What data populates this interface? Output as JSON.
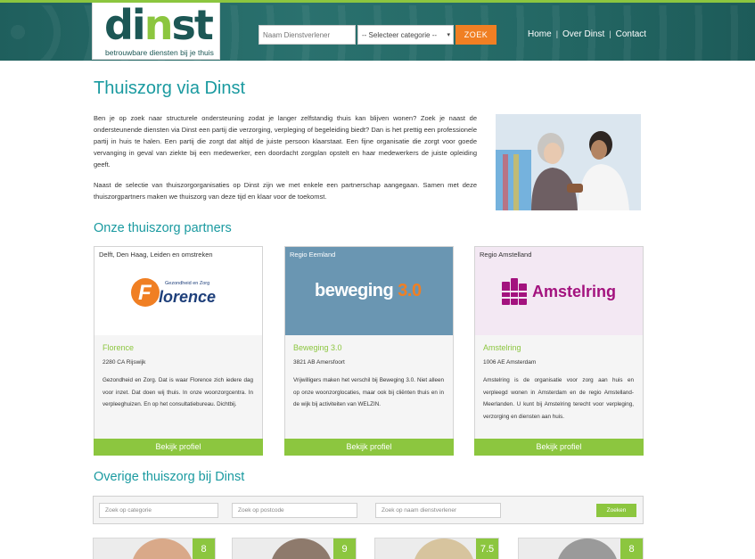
{
  "header": {
    "logo_text_dark": "di",
    "logo_text_dot": "n",
    "logo_text_rest": "st",
    "tagline": "betrouwbare diensten bij je thuis",
    "search_placeholder": "Naam Dienstverlener",
    "category_select": "-- Selecteer categorie --",
    "search_button": "ZOEK",
    "nav": [
      "Home",
      "Over Dinst",
      "Contact"
    ]
  },
  "intro": {
    "title": "Thuiszorg via Dinst",
    "paragraphs": [
      "Ben je op zoek naar structurele ondersteuning zodat je langer zelfstandig thuis kan blijven wonen? Zoek je naast de ondersteunende diensten via Dinst een partij die verzorging, verpleging of begeleiding biedt? Dan is het prettig een professionele partij in huis te halen. Een partij die zorgt dat altijd de juiste persoon klaarstaat. Een fijne organisatie die zorgt voor goede vervanging in geval van ziekte bij een medewerker, een doordacht zorgplan opstelt en haar medewerkers de juiste opleiding geeft.",
      "Naast de selectie van thuiszorgorganisaties op Dinst zijn we met enkele een partnerschap aangegaan. Samen met deze thuiszorgpartners maken we thuiszorg van deze tijd en klaar voor de toekomst."
    ]
  },
  "partners": {
    "title": "Onze thuiszorg partners",
    "cards": [
      {
        "region": "Delft, Den Haag, Leiden en omstreken",
        "logo_top": "Gezondheid en Zorg",
        "logo_main": "lorence",
        "name": "Florence",
        "address": "2280 CA Rijswijk",
        "description": "Gezondheid en Zorg. Dat is waar Florence zich iedere dag voor inzet. Dat doen wij thuis. In onze woonzorgcentra. In verpleeghuizen. En op het consultatiebureau. Dichtbij.",
        "button": "Bekijk profiel"
      },
      {
        "region": "Regio Eemland",
        "logo_main": "beweging",
        "logo_num": "3.0",
        "name": "Beweging 3.0",
        "address": "3821 AB Amersfoort",
        "description": "Vrijwilligers maken het verschil bij Beweging 3.0. Niet alleen op onze woonzorglocaties, maar ook bij cliënten thuis en in de wijk bij activiteiten van WELZIN.",
        "button": "Bekijk profiel"
      },
      {
        "region": "Regio Amstelland",
        "logo_main": "Amstelring",
        "name": "Amstelring",
        "address": "1006 AE Amsterdam",
        "description": "Amstelring is de organisatie voor zorg aan huis en verpleegd wonen in Amsterdam en de regio Amstelland-Meerlanden. U kunt bij Amstelring terecht voor verpleging, verzorging en diensten aan huis.",
        "button": "Bekijk profiel"
      }
    ]
  },
  "other": {
    "title": "Overige thuiszorg bij Dinst",
    "filter": {
      "category_placeholder": "Zoek op categorie",
      "postcode_placeholder": "Zoek op postcode",
      "name_placeholder": "Zoek op naam dienstverlener",
      "button": "Zoeken"
    },
    "scores": [
      "8",
      "9",
      "7.5",
      "8"
    ]
  },
  "colors": {
    "teal": "#1a9aa0",
    "green": "#8cc63f",
    "orange": "#f07f23",
    "header": "#246865",
    "beweging_bg": "#6a96b2",
    "amstelring_bg": "#f3e8f3",
    "amstelring_purple": "#a3127e"
  }
}
